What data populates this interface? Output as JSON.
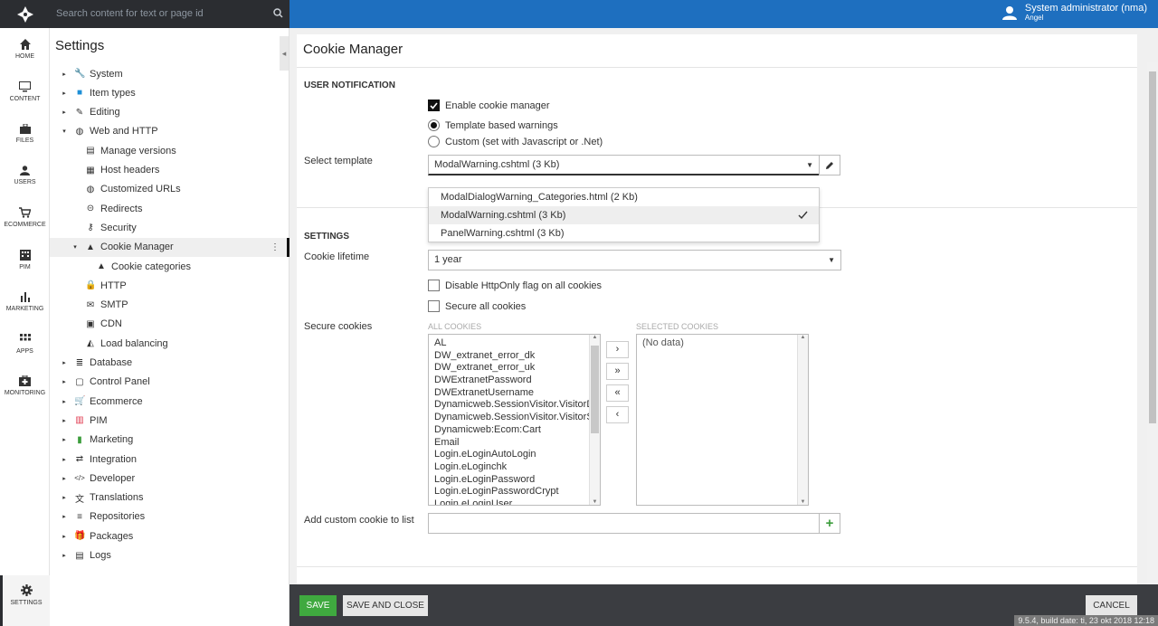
{
  "topbar": {
    "search_placeholder": "Search content for text or page id",
    "user_name": "System administrator (nma)",
    "user_sub": "Angel",
    "brand_color": "#1e6fbf"
  },
  "rail": [
    {
      "label": "HOME",
      "icon": "home-icon"
    },
    {
      "label": "CONTENT",
      "icon": "monitor-icon"
    },
    {
      "label": "FILES",
      "icon": "briefcase-icon"
    },
    {
      "label": "USERS",
      "icon": "user-icon"
    },
    {
      "label": "ECOMMERCE",
      "icon": "cart-icon"
    },
    {
      "label": "PIM",
      "icon": "building-icon"
    },
    {
      "label": "MARKETING",
      "icon": "bar-chart-icon"
    },
    {
      "label": "APPS",
      "icon": "grid-icon"
    },
    {
      "label": "MONITORING",
      "icon": "medkit-icon"
    },
    {
      "label": "SETTINGS",
      "icon": "gear-icon"
    }
  ],
  "tree": {
    "title": "Settings",
    "items": [
      {
        "label": "System",
        "icon": "wrench-icon",
        "level": 0,
        "arrow": "▸"
      },
      {
        "label": "Item types",
        "icon": "cube-icon",
        "level": 0,
        "arrow": "▸"
      },
      {
        "label": "Editing",
        "icon": "edit-icon",
        "level": 0,
        "arrow": "▸"
      },
      {
        "label": "Web and HTTP",
        "icon": "globe-icon",
        "level": 0,
        "arrow": "▾"
      },
      {
        "label": "Manage versions",
        "icon": "versions-icon",
        "level": 1,
        "arrow": ""
      },
      {
        "label": "Host headers",
        "icon": "server-icon",
        "level": 1,
        "arrow": ""
      },
      {
        "label": "Customized URLs",
        "icon": "globe-icon",
        "level": 1,
        "arrow": ""
      },
      {
        "label": "Redirects",
        "icon": "link-icon",
        "level": 1,
        "arrow": ""
      },
      {
        "label": "Security",
        "icon": "key-icon",
        "level": 1,
        "arrow": ""
      },
      {
        "label": "Cookie Manager",
        "icon": "cookie-icon",
        "level": 1,
        "arrow": "▾"
      },
      {
        "label": "Cookie categories",
        "icon": "cookie-icon",
        "level": 2,
        "arrow": ""
      },
      {
        "label": "HTTP",
        "icon": "lock-icon",
        "level": 1,
        "arrow": ""
      },
      {
        "label": "SMTP",
        "icon": "envelope-icon",
        "level": 1,
        "arrow": ""
      },
      {
        "label": "CDN",
        "icon": "image-icon",
        "level": 1,
        "arrow": ""
      },
      {
        "label": "Load balancing",
        "icon": "balance-icon",
        "level": 1,
        "arrow": ""
      },
      {
        "label": "Database",
        "icon": "database-icon",
        "level": 0,
        "arrow": "▸"
      },
      {
        "label": "Control Panel",
        "icon": "panel-icon",
        "level": 0,
        "arrow": "▸"
      },
      {
        "label": "Ecommerce",
        "icon": "cart-icon",
        "level": 0,
        "arrow": "▸"
      },
      {
        "label": "PIM",
        "icon": "pim-icon",
        "level": 0,
        "arrow": "▸"
      },
      {
        "label": "Marketing",
        "icon": "bar-chart-icon",
        "level": 0,
        "arrow": "▸"
      },
      {
        "label": "Integration",
        "icon": "exchange-icon",
        "level": 0,
        "arrow": "▸"
      },
      {
        "label": "Developer",
        "icon": "code-icon",
        "level": 0,
        "arrow": "▸"
      },
      {
        "label": "Translations",
        "icon": "translate-icon",
        "level": 0,
        "arrow": "▸"
      },
      {
        "label": "Repositories",
        "icon": "filter-icon",
        "level": 0,
        "arrow": "▸"
      },
      {
        "label": "Packages",
        "icon": "gift-icon",
        "level": 0,
        "arrow": "▸"
      },
      {
        "label": "Logs",
        "icon": "log-icon",
        "level": 0,
        "arrow": "▸"
      }
    ]
  },
  "main": {
    "title": "Cookie Manager",
    "user_notification": {
      "heading": "USER NOTIFICATION",
      "enable_label": "Enable cookie manager",
      "template_label": "Template based warnings",
      "custom_label": "Custom (set with Javascript or .Net)",
      "select_template_label": "Select template",
      "selected_template": "ModalWarning.cshtml (3 Kb)",
      "options": [
        "ModalDialogWarning_Categories.html (2 Kb)",
        "ModalWarning.cshtml (3 Kb)",
        "PanelWarning.cshtml (3 Kb)"
      ]
    },
    "settings": {
      "heading": "SETTINGS",
      "lifetime_label": "Cookie lifetime",
      "lifetime_value": "1 year",
      "httponly_label": "Disable HttpOnly flag on all cookies",
      "secure_all_label": "Secure all cookies",
      "secure_cookies_label": "Secure cookies",
      "all_cookies_header": "ALL COOKIES",
      "selected_cookies_header": "SELECTED COOKIES",
      "all_cookies": [
        "AL",
        "DW_extranet_error_dk",
        "DW_extranet_error_uk",
        "DWExtranetPassword",
        "DWExtranetUsername",
        "Dynamicweb.SessionVisitor.VisitorDyna",
        "Dynamicweb.SessionVisitor.VisitorSessi",
        "Dynamicweb:Ecom:Cart",
        "Email",
        "Login.eLoginAutoLogin",
        "Login.eLoginchk",
        "Login.eLoginPassword",
        "Login.eLoginPasswordCrypt",
        "Login.eLoginUser"
      ],
      "selected_empty": "(No data)",
      "move_buttons": [
        "›",
        "»",
        "«",
        "‹"
      ],
      "add_custom_label": "Add custom cookie to list"
    }
  },
  "footer": {
    "save": "SAVE",
    "save_close": "SAVE AND CLOSE",
    "cancel": "CANCEL",
    "build": "9.5.4, build date: ti, 23 okt 2018 12:18"
  }
}
